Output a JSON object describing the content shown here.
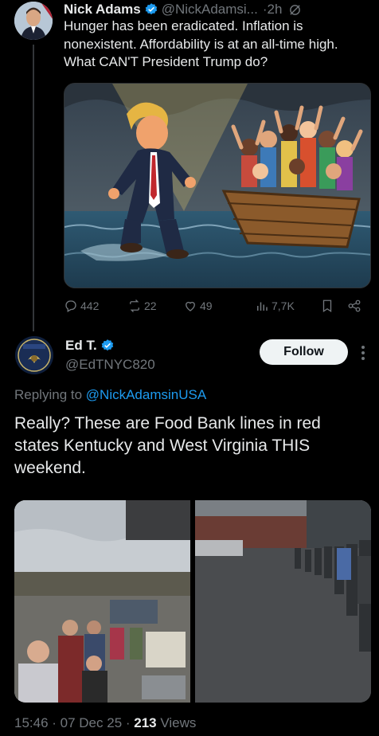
{
  "tweet1": {
    "name": "Nick Adams",
    "handle": "@NickAdamsi...",
    "time": "·2h",
    "text": "Hunger has been eradicated. Inflation is nonexistent. Affordability is at an all-time high. What CAN'T President Trump do?",
    "image_alt": "Cartoon of Trump walking on water toward a boat of cheering people",
    "stats": {
      "replies": "442",
      "reposts": "22",
      "likes": "49",
      "views": "7,7K"
    }
  },
  "tweet2": {
    "name": "Ed T.",
    "handle": "@EdTNYC820",
    "follow_label": "Follow",
    "replying_prefix": "Replying to ",
    "replying_to": "@NickAdamsinUSA",
    "text": "Really? These are Food Bank lines in red states Kentucky and West Virginia THIS weekend.",
    "footer_time": "15:46 · 07 Dec 25 · ",
    "footer_views_count": "213",
    "footer_views_label": " Views"
  },
  "colors": {
    "accent": "#1d9bf0",
    "muted": "#71767b",
    "text": "#e7e9ea",
    "background": "#000000"
  },
  "icons": [
    "verified-icon",
    "grok-icon",
    "reply-icon",
    "retweet-icon",
    "heart-icon",
    "views-icon",
    "bookmark-icon",
    "share-icon",
    "more-icon"
  ]
}
